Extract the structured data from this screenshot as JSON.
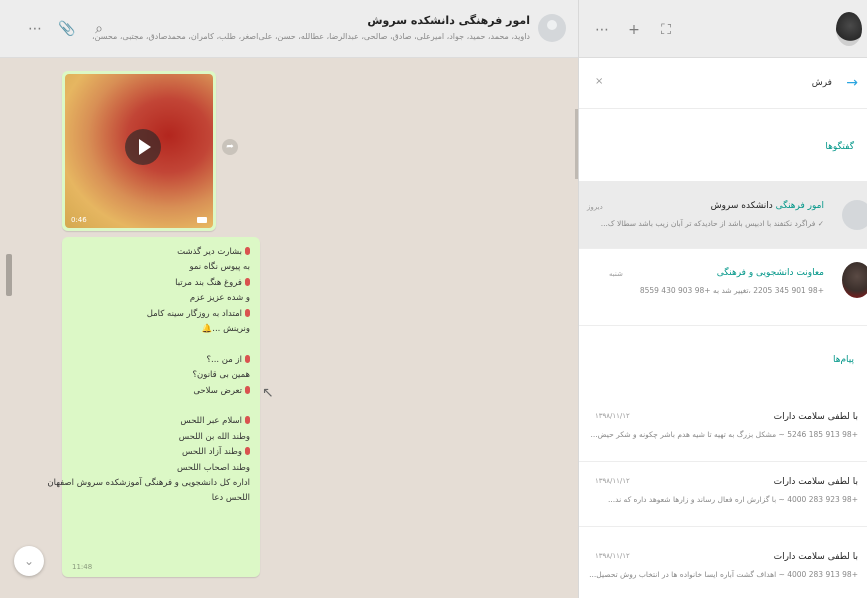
{
  "chat": {
    "title": "امور فرهنگی دانشکده سروش",
    "members": "داوید، محمد، حمید، جواد، امیرعلی، صادق، صالحی، عبدالرضا، عطالله، حسن، علی‌اصغر، طلب، کامران، محمدصادق، مجتبی، محسن، …",
    "video": {
      "footer": "0:46"
    },
    "message_lines": [
      {
        "mic": true,
        "text": "بشارت دیر گذشت"
      },
      {
        "mic": false,
        "text": "به پیوس نگاه نمو"
      },
      {
        "mic": true,
        "text": "فروغ هنگ بند مرتبا"
      },
      {
        "mic": false,
        "text": "و شده عزیز عزم"
      },
      {
        "mic": true,
        "text": "امتداد به روزگار سینه کامل"
      },
      {
        "mic": false,
        "text": "ونرینش ...🔔"
      },
      {
        "mic": false,
        "text": ""
      },
      {
        "mic": true,
        "text": "از من ...؟"
      },
      {
        "mic": false,
        "text": "همین بی قانون؟"
      },
      {
        "mic": true,
        "text": "تعرض سلاحی"
      },
      {
        "mic": false,
        "text": ""
      },
      {
        "mic": true,
        "text": "اسلام عبر اللحس"
      },
      {
        "mic": false,
        "text": "وطند الله بن اللحس"
      },
      {
        "mic": true,
        "text": "وطند آزاد اللحس"
      },
      {
        "mic": false,
        "text": "وطند اصحاب اللحس"
      },
      {
        "mic": false,
        "text": "اداره کل دانشجویی و فرهنگی آموزشکده سروش اصفهان"
      },
      {
        "mic": false,
        "text": "اللحس دعا"
      }
    ],
    "message_time": "11:48"
  },
  "sidebar": {
    "search_value": "فرش",
    "sections": {
      "chats": "گفتگوها",
      "messages": "پیام‌ها"
    },
    "results": [
      {
        "title_highlight": "امور فرهنگی",
        "title_rest": " دانشکده سروش",
        "subtitle": "✓ فراگرد نکتفند با ادبیس باشد از حادیدکه تر آبان زیب باشد سطالا ک...",
        "date": "دیروز"
      },
      {
        "title_highlight": "معاونت دانشجویی و فرهنگی",
        "title_rest": "",
        "subtitle": "+98 901 345 2205 ،تغییر شد به +98 903 430 8559",
        "date": "شنبه"
      }
    ],
    "messages": [
      {
        "title": "با لطفی سلامت دارات",
        "date": "۱۳۹۸/۱۱/۱۲",
        "snippet": "+98 913 185 5246 ~ مشکل بزرگ به تهیه تا شیه هدم باشر چکونه و شکر حیض..."
      },
      {
        "title": "با لطفی سلامت دارات",
        "date": "۱۳۹۸/۱۱/۱۲",
        "snippet": "+98 923 283 4000 ~ با گزارش اره فعال رساند و زارها شعوهد داره که ند..."
      },
      {
        "title": "با لطفی سلامت دارات",
        "date": "۱۳۹۸/۱۱/۱۲",
        "snippet": "+98 913 283 4000 ~ اهداف گشت آباره ایسا خانواده ها در انتخاب روش تحصیل..."
      }
    ]
  }
}
